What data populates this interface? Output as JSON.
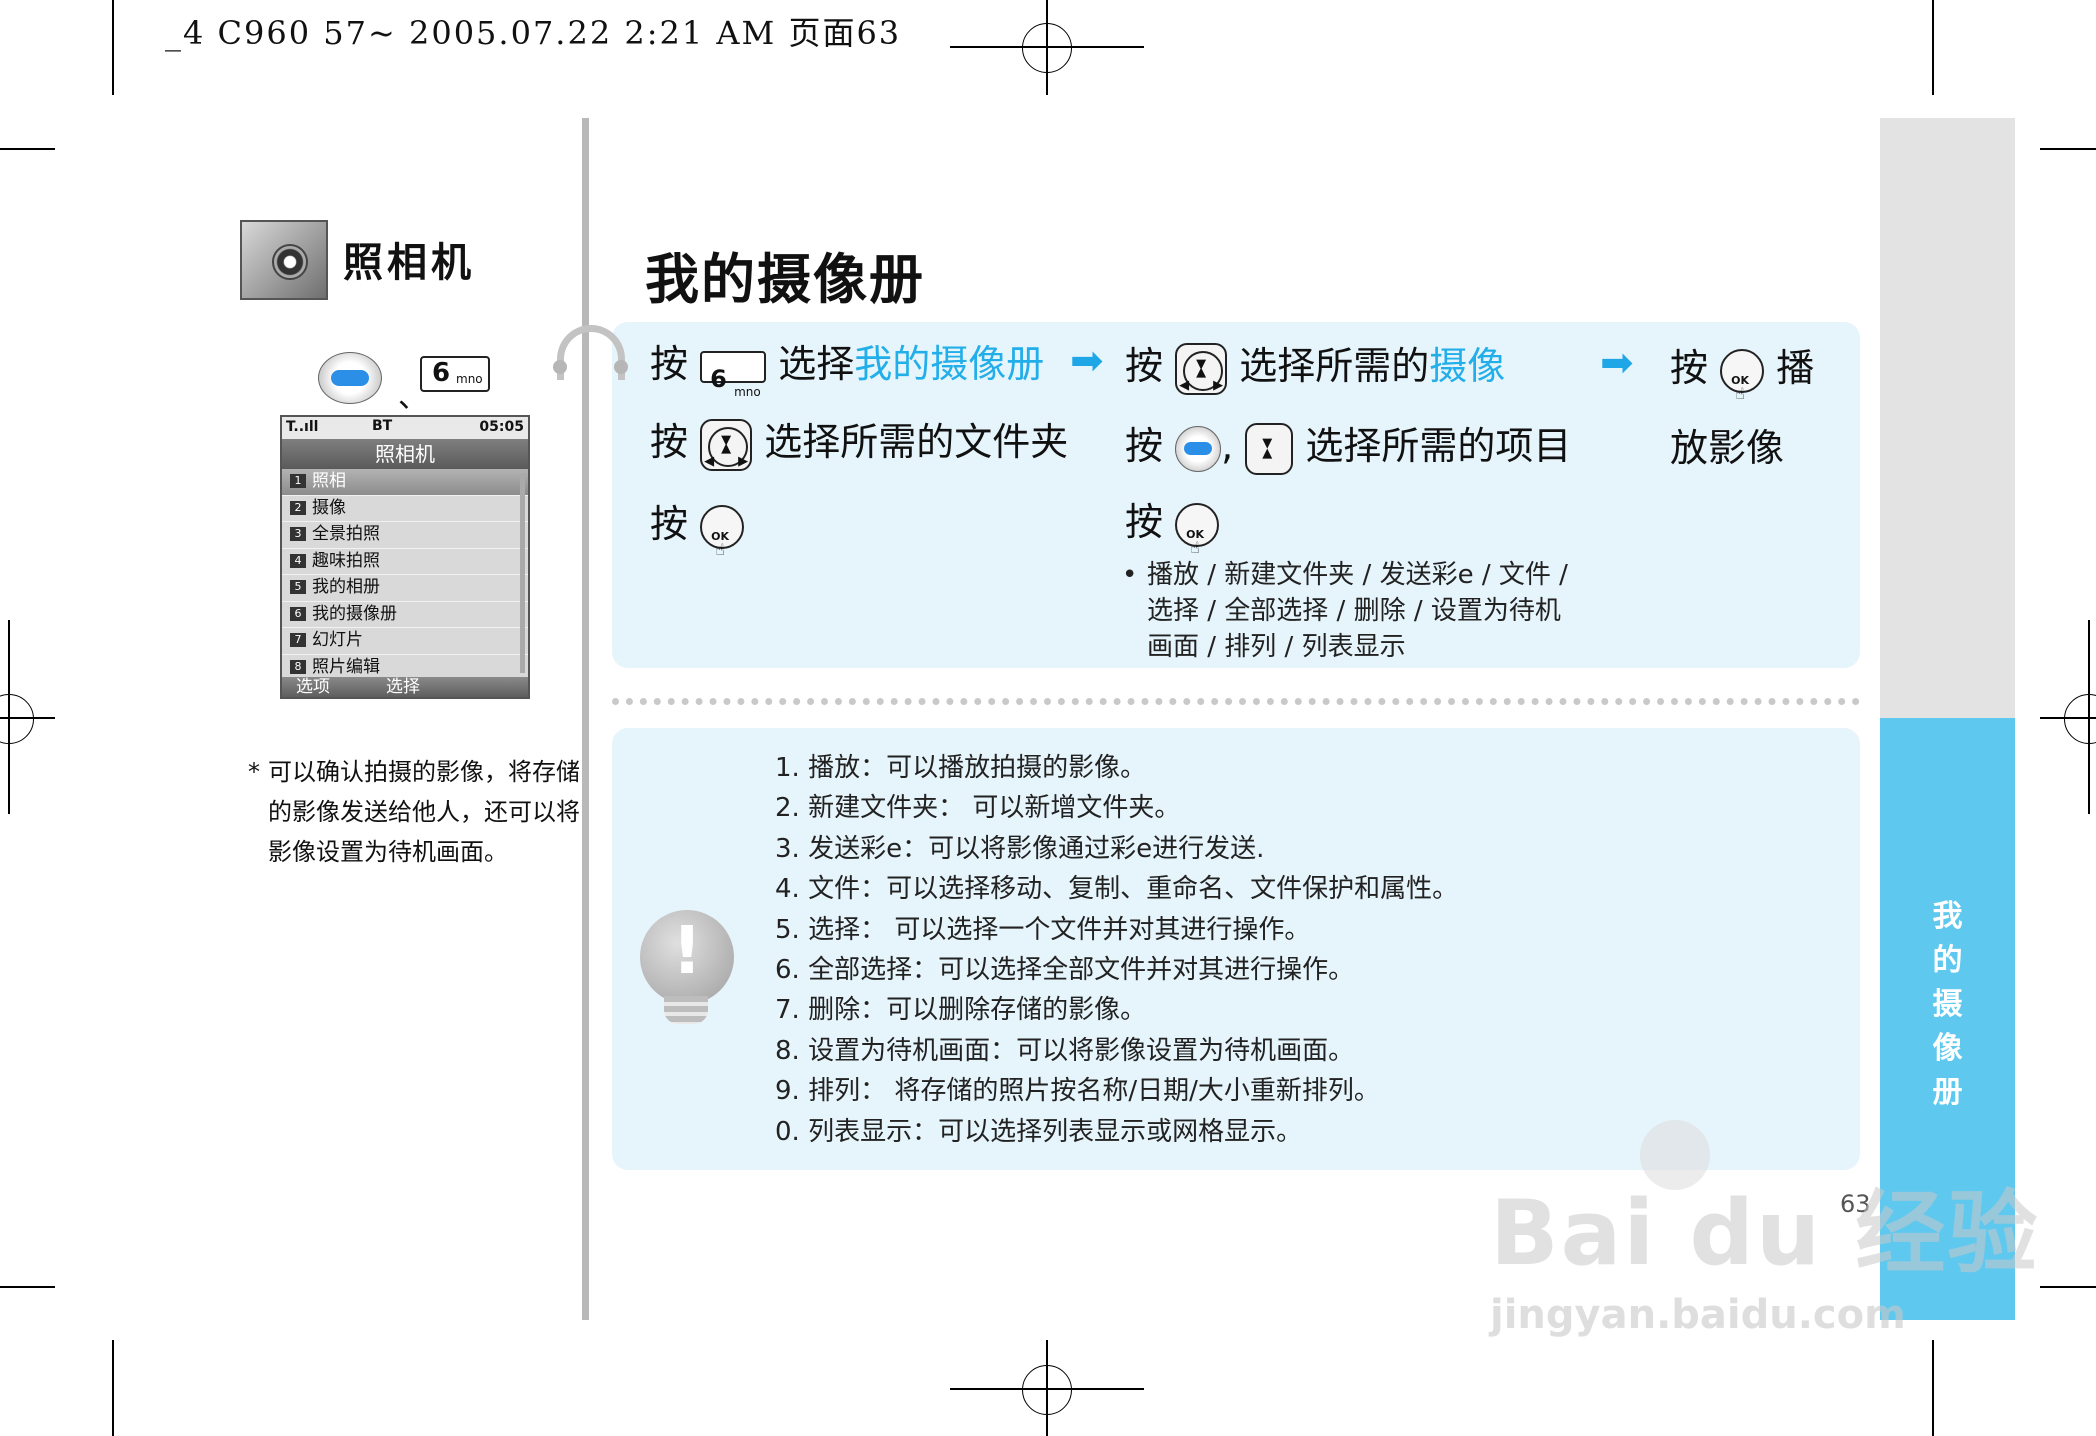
{
  "print_header": "_4 C960 57~ 2005.07.22 2:21 AM 页面63",
  "section": {
    "title": "照相机"
  },
  "left_keys": {
    "separator": "、",
    "key_six_digit": "6",
    "key_six_sub": "mno"
  },
  "phone": {
    "status_signal": "T..ıll",
    "status_icon": "BT",
    "status_time": "05:05",
    "title": "照相机",
    "items": [
      {
        "num": "1",
        "label": "照相"
      },
      {
        "num": "2",
        "label": "摄像"
      },
      {
        "num": "3",
        "label": "全景拍照"
      },
      {
        "num": "4",
        "label": "趣味拍照"
      },
      {
        "num": "5",
        "label": "我的相册"
      },
      {
        "num": "6",
        "label": "我的摄像册"
      },
      {
        "num": "7",
        "label": "幻灯片"
      },
      {
        "num": "8",
        "label": "照片编辑"
      }
    ],
    "soft_left": "选项",
    "soft_right": "选择"
  },
  "left_note": {
    "asterisk": "*",
    "text": "可以确认拍摄的影像，将存储的影像发送给他人，还可以将影像设置为待机画面。"
  },
  "main": {
    "title": "我的摄像册",
    "step1": {
      "a": "按",
      "b": "选择",
      "c": "我的摄像册",
      "d": "按",
      "e": "选择所需的文件夹",
      "f": "按"
    },
    "step2": {
      "a": "按",
      "b": "选择所需的",
      "c": "摄像",
      "d": "按",
      "e": ",",
      "f": "选择所需的项目",
      "g": "按"
    },
    "step3": {
      "a": "按",
      "b": "播",
      "c": "放影像"
    },
    "arrow": "➡",
    "options_bullet": "•",
    "options": [
      "播放 / 新建文件夹 / 发送彩e / 文件 /",
      "选择 / 全部选择 / 删除 / 设置为待机",
      "画面 / 排列 / 列表显示"
    ]
  },
  "notes": [
    "1. 播放：可以播放拍摄的影像。",
    "2. 新建文件夹： 可以新增文件夹。",
    "3. 发送彩e：可以将影像通过彩e进行发送.",
    "4. 文件：可以选择移动、复制、重命名、文件保护和属性。",
    "5. 选择：   可以选择一个文件并对其进行操作。",
    "6. 全部选择：可以选择全部文件并对其进行操作。",
    "7. 删除：可以删除存储的影像。",
    "8. 设置为待机画面：可以将影像设置为待机画面。",
    "9. 排列： 将存储的照片按名称/日期/大小重新排列。",
    "0. 列表显示：可以选择列表显示或网格显示。"
  ],
  "side_tab": [
    "我",
    "的",
    "摄",
    "像",
    "册"
  ],
  "page_number": "63",
  "watermark": {
    "main": "Bai du 经验",
    "url": "jingyan.baidu.com"
  },
  "key_labels": {
    "ok": "OK"
  },
  "colors": {
    "accent_blue": "#22aee8",
    "side_blue": "#5fc8ef",
    "box_bg": "#e6f4fb"
  }
}
